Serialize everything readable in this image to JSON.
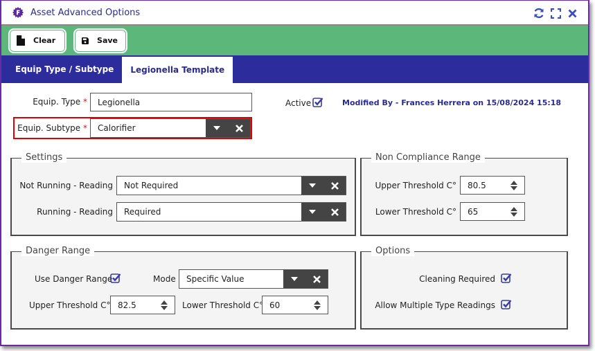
{
  "window": {
    "title": "Asset Advanced Options",
    "logo_icon": "app-logo-gear-icon",
    "actions": [
      {
        "name": "refresh",
        "icon": "refresh-icon"
      },
      {
        "name": "maximize",
        "icon": "expand-icon"
      },
      {
        "name": "close",
        "icon": "close-icon"
      }
    ]
  },
  "toolbar": {
    "clear_label": "Clear",
    "clear_icon": "file-icon",
    "save_label": "Save",
    "save_icon": "floppy-disk-icon"
  },
  "tabs": [
    {
      "label": "Equip Type / Subtype",
      "active": false
    },
    {
      "label": "Legionella Template",
      "active": true
    }
  ],
  "header_fields": {
    "equip_type_label": "Equip. Type",
    "equip_type_value": "Legionella",
    "equip_subtype_label": "Equip. Subtype",
    "equip_subtype_value": "Calorifier",
    "required_marker": "*",
    "active_label": "Active",
    "active_checked": true,
    "modified_by": "Modified By -  Frances Herrera on 15/08/2024 15:18"
  },
  "settings": {
    "legend": "Settings",
    "not_running_label": "Not Running - Reading",
    "not_running_value": "Not Required",
    "running_label": "Running - Reading",
    "running_value": "Required"
  },
  "non_compliance": {
    "legend": "Non Compliance Range",
    "upper_label": "Upper Threshold C°",
    "upper_value": "80.5",
    "lower_label": "Lower Threshold C°",
    "lower_value": "65"
  },
  "danger_range": {
    "legend": "Danger Range",
    "use_label": "Use Danger Range",
    "use_checked": true,
    "mode_label": "Mode",
    "mode_value": "Specific Value",
    "upper_label": "Upper Threshold C°",
    "upper_value": "82.5",
    "lower_label": "Lower Threshold C°",
    "lower_value": "60"
  },
  "options": {
    "legend": "Options",
    "cleaning_label": "Cleaning Required",
    "cleaning_checked": true,
    "multiple_label": "Allow Multiple Type Readings",
    "multiple_checked": true
  },
  "colors": {
    "window_border": "#6a2aa8",
    "toolbar_bg": "#5bb87a",
    "tabbar_bg": "#2c2c9c",
    "accent_text": "#2b2b8c",
    "highlight_border": "#e00000",
    "combo_button_bg": "#444444"
  }
}
